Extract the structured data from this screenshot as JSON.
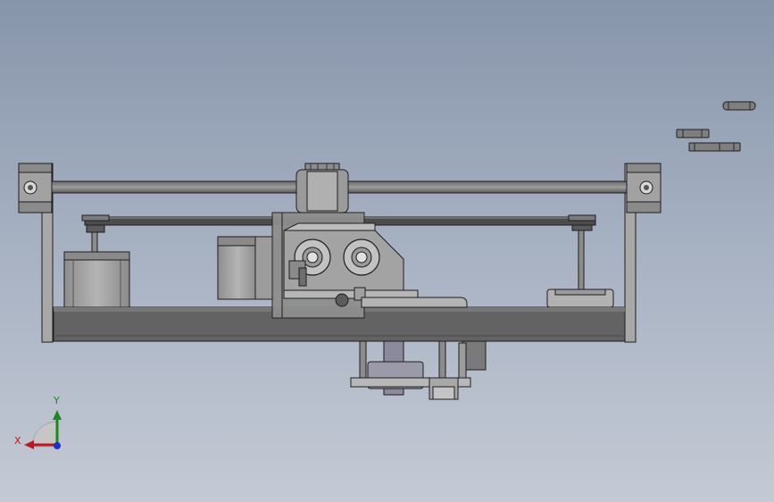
{
  "viewport": {
    "background_top": "#8795ab",
    "background_bottom": "#c4cad5"
  },
  "triad": {
    "x_label": "X",
    "y_label": "Y",
    "x_color": "#c0161c",
    "y_color": "#1a8a1a",
    "z_color": "#1c2fd0"
  },
  "model": {
    "part_color": "#9a9a9a",
    "edge_color": "#1e1e1e",
    "base_color": "#636363",
    "motor_color": "#a6a6a6"
  }
}
